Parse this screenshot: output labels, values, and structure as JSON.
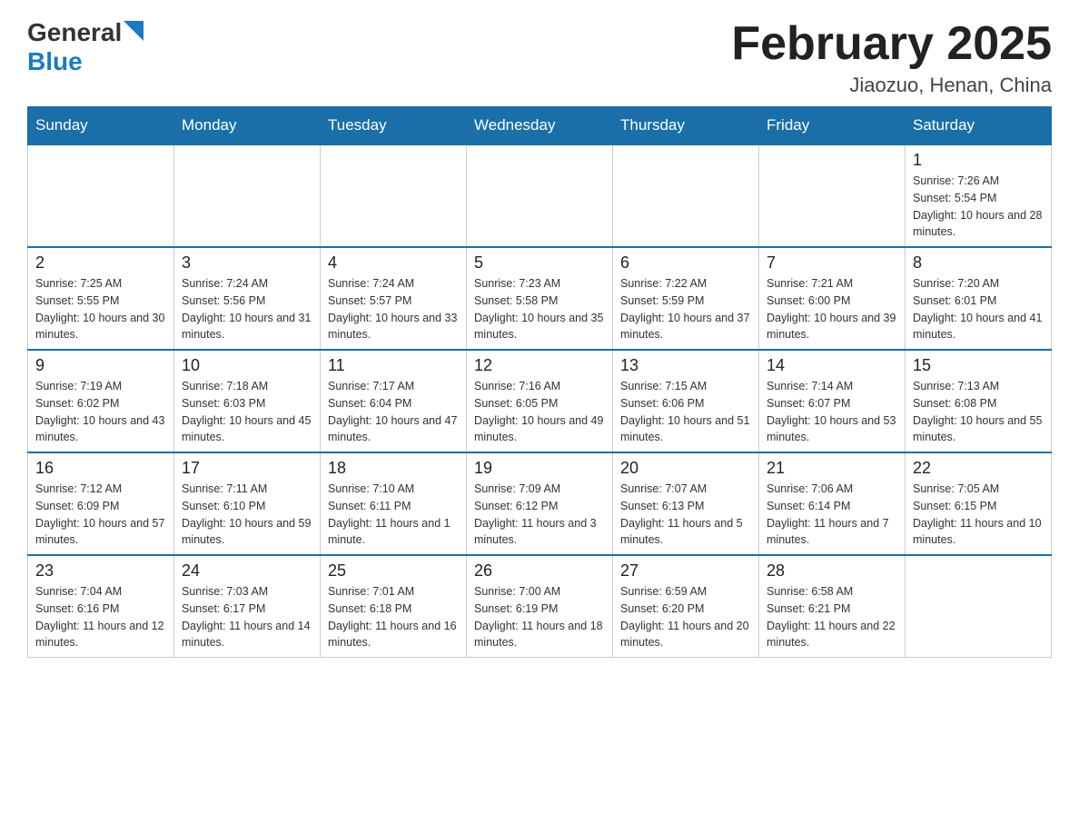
{
  "header": {
    "logo_general": "General",
    "logo_blue": "Blue",
    "month_title": "February 2025",
    "location": "Jiaozuo, Henan, China"
  },
  "days_of_week": [
    "Sunday",
    "Monday",
    "Tuesday",
    "Wednesday",
    "Thursday",
    "Friday",
    "Saturday"
  ],
  "weeks": [
    [
      {
        "day": "",
        "info": ""
      },
      {
        "day": "",
        "info": ""
      },
      {
        "day": "",
        "info": ""
      },
      {
        "day": "",
        "info": ""
      },
      {
        "day": "",
        "info": ""
      },
      {
        "day": "",
        "info": ""
      },
      {
        "day": "1",
        "info": "Sunrise: 7:26 AM\nSunset: 5:54 PM\nDaylight: 10 hours and 28 minutes."
      }
    ],
    [
      {
        "day": "2",
        "info": "Sunrise: 7:25 AM\nSunset: 5:55 PM\nDaylight: 10 hours and 30 minutes."
      },
      {
        "day": "3",
        "info": "Sunrise: 7:24 AM\nSunset: 5:56 PM\nDaylight: 10 hours and 31 minutes."
      },
      {
        "day": "4",
        "info": "Sunrise: 7:24 AM\nSunset: 5:57 PM\nDaylight: 10 hours and 33 minutes."
      },
      {
        "day": "5",
        "info": "Sunrise: 7:23 AM\nSunset: 5:58 PM\nDaylight: 10 hours and 35 minutes."
      },
      {
        "day": "6",
        "info": "Sunrise: 7:22 AM\nSunset: 5:59 PM\nDaylight: 10 hours and 37 minutes."
      },
      {
        "day": "7",
        "info": "Sunrise: 7:21 AM\nSunset: 6:00 PM\nDaylight: 10 hours and 39 minutes."
      },
      {
        "day": "8",
        "info": "Sunrise: 7:20 AM\nSunset: 6:01 PM\nDaylight: 10 hours and 41 minutes."
      }
    ],
    [
      {
        "day": "9",
        "info": "Sunrise: 7:19 AM\nSunset: 6:02 PM\nDaylight: 10 hours and 43 minutes."
      },
      {
        "day": "10",
        "info": "Sunrise: 7:18 AM\nSunset: 6:03 PM\nDaylight: 10 hours and 45 minutes."
      },
      {
        "day": "11",
        "info": "Sunrise: 7:17 AM\nSunset: 6:04 PM\nDaylight: 10 hours and 47 minutes."
      },
      {
        "day": "12",
        "info": "Sunrise: 7:16 AM\nSunset: 6:05 PM\nDaylight: 10 hours and 49 minutes."
      },
      {
        "day": "13",
        "info": "Sunrise: 7:15 AM\nSunset: 6:06 PM\nDaylight: 10 hours and 51 minutes."
      },
      {
        "day": "14",
        "info": "Sunrise: 7:14 AM\nSunset: 6:07 PM\nDaylight: 10 hours and 53 minutes."
      },
      {
        "day": "15",
        "info": "Sunrise: 7:13 AM\nSunset: 6:08 PM\nDaylight: 10 hours and 55 minutes."
      }
    ],
    [
      {
        "day": "16",
        "info": "Sunrise: 7:12 AM\nSunset: 6:09 PM\nDaylight: 10 hours and 57 minutes."
      },
      {
        "day": "17",
        "info": "Sunrise: 7:11 AM\nSunset: 6:10 PM\nDaylight: 10 hours and 59 minutes."
      },
      {
        "day": "18",
        "info": "Sunrise: 7:10 AM\nSunset: 6:11 PM\nDaylight: 11 hours and 1 minute."
      },
      {
        "day": "19",
        "info": "Sunrise: 7:09 AM\nSunset: 6:12 PM\nDaylight: 11 hours and 3 minutes."
      },
      {
        "day": "20",
        "info": "Sunrise: 7:07 AM\nSunset: 6:13 PM\nDaylight: 11 hours and 5 minutes."
      },
      {
        "day": "21",
        "info": "Sunrise: 7:06 AM\nSunset: 6:14 PM\nDaylight: 11 hours and 7 minutes."
      },
      {
        "day": "22",
        "info": "Sunrise: 7:05 AM\nSunset: 6:15 PM\nDaylight: 11 hours and 10 minutes."
      }
    ],
    [
      {
        "day": "23",
        "info": "Sunrise: 7:04 AM\nSunset: 6:16 PM\nDaylight: 11 hours and 12 minutes."
      },
      {
        "day": "24",
        "info": "Sunrise: 7:03 AM\nSunset: 6:17 PM\nDaylight: 11 hours and 14 minutes."
      },
      {
        "day": "25",
        "info": "Sunrise: 7:01 AM\nSunset: 6:18 PM\nDaylight: 11 hours and 16 minutes."
      },
      {
        "day": "26",
        "info": "Sunrise: 7:00 AM\nSunset: 6:19 PM\nDaylight: 11 hours and 18 minutes."
      },
      {
        "day": "27",
        "info": "Sunrise: 6:59 AM\nSunset: 6:20 PM\nDaylight: 11 hours and 20 minutes."
      },
      {
        "day": "28",
        "info": "Sunrise: 6:58 AM\nSunset: 6:21 PM\nDaylight: 11 hours and 22 minutes."
      },
      {
        "day": "",
        "info": ""
      }
    ]
  ]
}
